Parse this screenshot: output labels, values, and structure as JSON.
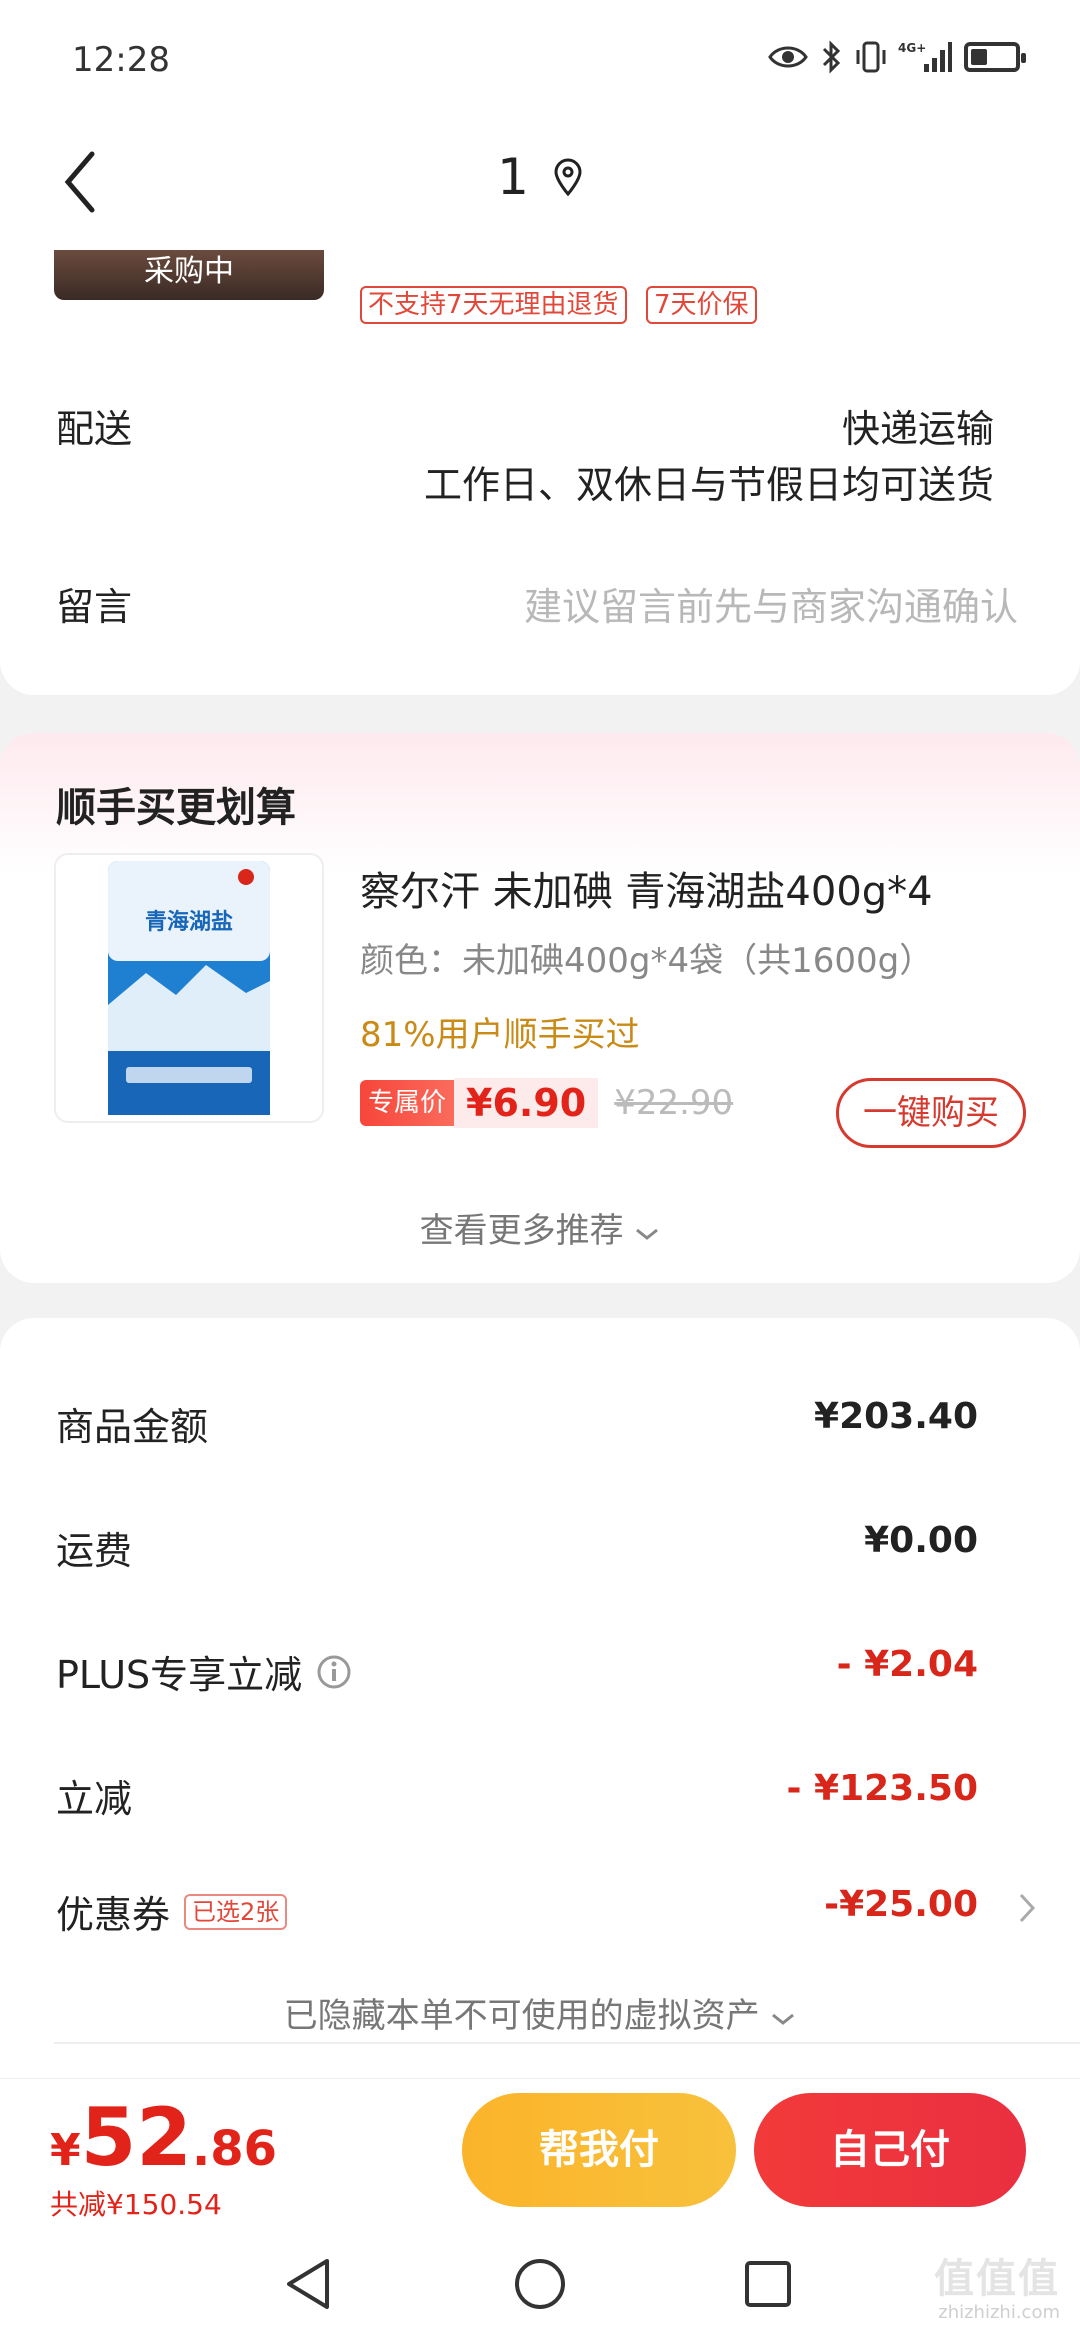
{
  "status_bar": {
    "time": "12:28",
    "network": "4G+"
  },
  "nav": {
    "title": "1"
  },
  "product_top": {
    "thumb_overlay": "采购中",
    "tags": [
      "不支持7天无理由退货",
      "7天价保"
    ]
  },
  "delivery": {
    "label": "配送",
    "method": "快递运输",
    "schedule": "工作日、双休日与节假日均可送货"
  },
  "message": {
    "label": "留言",
    "placeholder": "建议留言前先与商家沟通确认"
  },
  "recommendation": {
    "title": "顺手买更划算",
    "product_name": "察尔汗 未加碘 青海湖盐400g*4",
    "spec": "颜色：未加碘400g*4袋（共1600g）",
    "social_proof": "81%用户顺手买过",
    "badge": "专属价",
    "price": "¥6.90",
    "original_price": "¥22.90",
    "buy_button": "一键购买",
    "see_more": "查看更多推荐",
    "package_text": "青海湖盐"
  },
  "totals": {
    "rows": [
      {
        "label": "商品金额",
        "value": "¥203.40"
      },
      {
        "label": "运费",
        "value": "¥0.00"
      },
      {
        "label": "PLUS专享立减",
        "value": "- ¥2.04"
      },
      {
        "label": "立减",
        "value": "- ¥123.50"
      },
      {
        "label": "优惠券",
        "badge": "已选2张",
        "value": "-¥25.00"
      }
    ],
    "hidden_assets": "已隐藏本单不可使用的虚拟资产"
  },
  "pay_bar": {
    "currency": "¥",
    "amount_int": "52",
    "amount_dec": ".86",
    "saved": "共减¥150.54",
    "help_pay": "帮我付",
    "self_pay": "自己付"
  },
  "watermark": {
    "main": "值值值",
    "sub": "zhizhizhi.com"
  },
  "colors": {
    "accent_red": "#e2231a",
    "pay_yellow": "#fbb42a",
    "pay_red": "#ea2f40"
  }
}
